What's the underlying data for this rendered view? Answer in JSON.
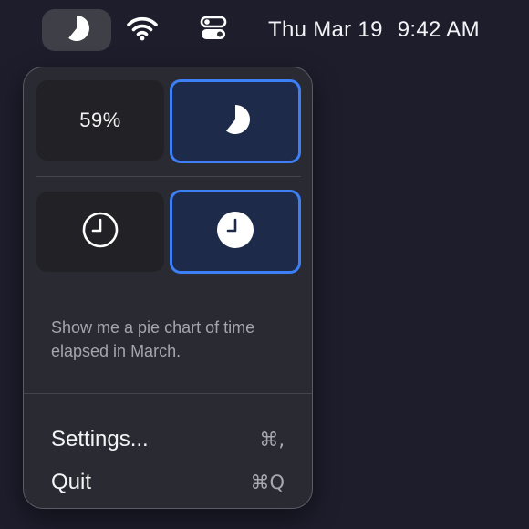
{
  "menubar": {
    "icons": {
      "pie": "pie-icon",
      "wifi": "wifi-icon",
      "control_center": "control-center-icon"
    },
    "date": "Thu Mar 19",
    "time": "9:42 AM"
  },
  "panel": {
    "mode_tiles": {
      "percent_label": "59%",
      "pie_icon": "pie-icon",
      "selected": "pie"
    },
    "clock_tiles": {
      "outline_icon": "clock-outline-icon",
      "filled_icon": "clock-filled-icon",
      "selected": "filled"
    },
    "description": "Show me a pie chart of time elapsed in March.",
    "menu": [
      {
        "label": "Settings...",
        "shortcut": "⌘,"
      },
      {
        "label": "Quit",
        "shortcut": "⌘Q"
      }
    ]
  },
  "colors": {
    "background": "#1d1d2c",
    "panel": "#2a2a33",
    "tile": "#222226",
    "selected_tile": "#1d2a4a",
    "accent": "#3d7ff5",
    "secondary_text": "#a5a5b0"
  }
}
